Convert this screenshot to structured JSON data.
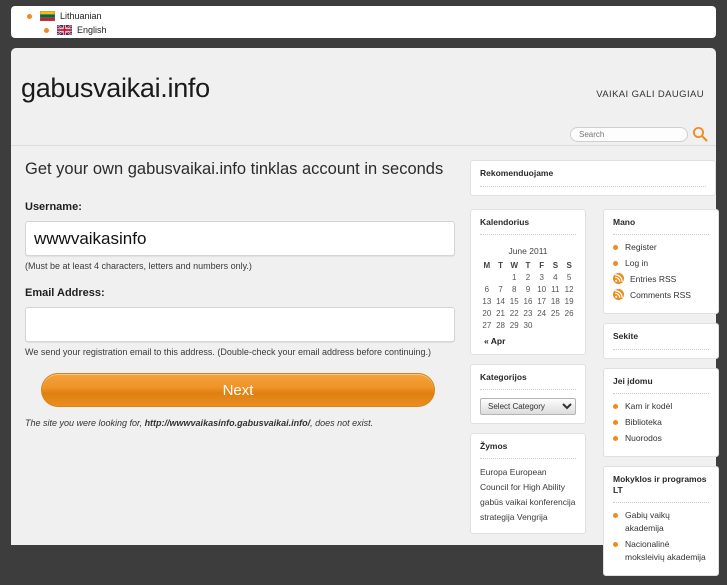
{
  "langbar": {
    "items": [
      {
        "label": "Lithuanian",
        "flag": "lithuanian-flag",
        "active": true
      },
      {
        "label": "English",
        "flag": "uk-flag",
        "active": false
      }
    ]
  },
  "header": {
    "site_title": "gabusvaikai.info",
    "tagline": "VAIKAI GALI DAUGIAU",
    "search": {
      "placeholder": "Search",
      "value": ""
    }
  },
  "signup": {
    "lead": "Get your own gabusvaikai.info tinklas account in seconds",
    "username_label": "Username:",
    "username_value": "wwwvaikasinfo",
    "username_hint": "(Must be at least 4 characters, letters and numbers only.)",
    "email_label": "Email Address:",
    "email_value": "",
    "email_hint": "We send your registration email to this address. (Double-check your email address before continuing.)",
    "next_label": "Next",
    "notexist_prefix": "The site you were looking for, ",
    "notexist_url": "http://wwwvaikasinfo.gabusvaikai.info/",
    "notexist_suffix": ", does not exist."
  },
  "sidebar": {
    "featured": {
      "title": "Rekomenduojame"
    },
    "calendar": {
      "title": "Kalendorius",
      "caption": "June 2011",
      "weekdays": [
        "M",
        "T",
        "W",
        "T",
        "F",
        "S",
        "S"
      ],
      "weeks": [
        [
          "",
          "",
          "1",
          "2",
          "3",
          "4",
          "5"
        ],
        [
          "6",
          "7",
          "8",
          "9",
          "10",
          "11",
          "12"
        ],
        [
          "13",
          "14",
          "15",
          "16",
          "17",
          "18",
          "19"
        ],
        [
          "20",
          "21",
          "22",
          "23",
          "24",
          "25",
          "26"
        ],
        [
          "27",
          "28",
          "29",
          "30",
          "",
          "",
          ""
        ]
      ],
      "prev_label": "« Apr"
    },
    "categories": {
      "title": "Kategorijos",
      "selected": "Select Category"
    },
    "tags": {
      "title": "Žymos",
      "items": [
        "Europa",
        "European Council for High Ability",
        "gabūs vaikai",
        "konferencija",
        "strategija",
        "Vengrija"
      ]
    },
    "meta": {
      "title": "Mano",
      "items": [
        {
          "label": "Register",
          "icon": "bullet-icon"
        },
        {
          "label": "Log in",
          "icon": "bullet-icon"
        },
        {
          "label": "Entries RSS",
          "icon": "rss-icon"
        },
        {
          "label": "Comments RSS",
          "icon": "rss-icon"
        }
      ]
    },
    "follow": {
      "title": "Sekite"
    },
    "interesting": {
      "title": "Jei įdomu",
      "items": [
        "Kam ir kodėl",
        "Biblioteka",
        "Nuorodos"
      ]
    },
    "schools": {
      "title": "Mokyklos ir programos LT",
      "items": [
        "Gabių vaikų akademija",
        "Nacionalinė moksleivių akademija"
      ]
    }
  },
  "colors": {
    "accent": "#f08a1c",
    "page_bg": "#f0f0f0",
    "outer_bg": "#3d3d3d",
    "button_top": "#f5a33f",
    "button_bottom": "#e07f11"
  }
}
